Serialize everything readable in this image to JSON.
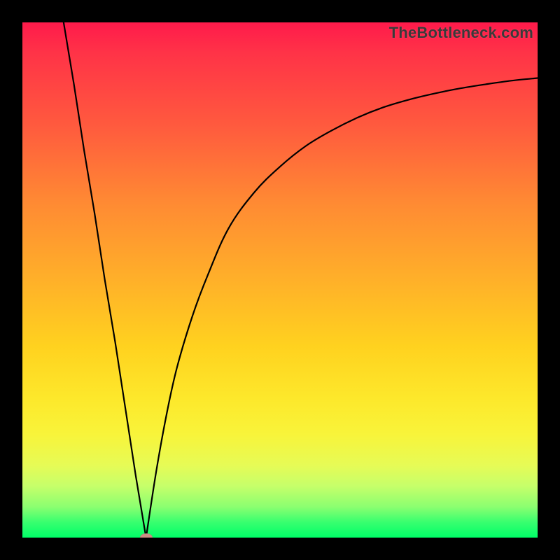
{
  "watermark": "TheBottleneck.com",
  "colors": {
    "frame": "#000000",
    "curve": "#000000",
    "marker_fill": "#cc8e84"
  },
  "chart_data": {
    "type": "line",
    "title": "",
    "xlabel": "",
    "ylabel": "",
    "xlim": [
      0,
      100
    ],
    "ylim": [
      0,
      100
    ],
    "grid": false,
    "legend": false,
    "series": [
      {
        "name": "left-branch",
        "x": [
          8,
          10,
          12,
          14,
          16,
          18,
          20,
          22,
          24
        ],
        "y": [
          100,
          88,
          75,
          63,
          50,
          38,
          25,
          12,
          0
        ]
      },
      {
        "name": "right-branch",
        "x": [
          24,
          26,
          28,
          30,
          33,
          36,
          40,
          45,
          50,
          55,
          60,
          65,
          70,
          75,
          80,
          85,
          90,
          95,
          100
        ],
        "y": [
          0,
          13,
          24,
          33,
          43,
          51,
          60,
          67,
          72,
          76,
          79,
          81.5,
          83.5,
          85,
          86.2,
          87.2,
          88,
          88.7,
          89.2
        ]
      }
    ],
    "marker": {
      "x": 24,
      "y": 0
    },
    "annotations": []
  }
}
